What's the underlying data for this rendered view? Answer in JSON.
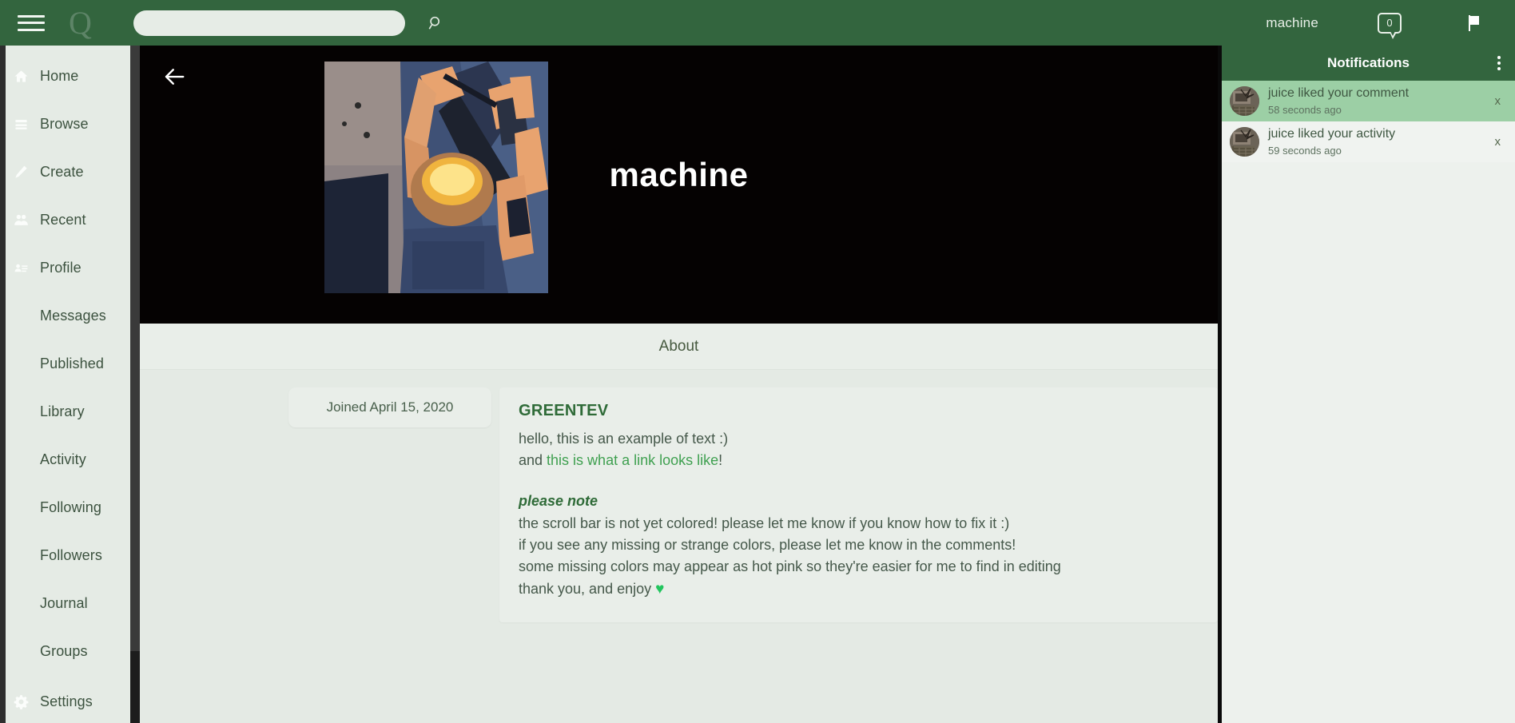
{
  "topbar": {
    "menu_icon": "hamburger-icon",
    "brand_mark": "Q",
    "search_value": "",
    "search_placeholder": "",
    "search_icon": "search-icon",
    "username": "machine",
    "messages_count": "0",
    "flag_icon": "flag-icon"
  },
  "sidebar": {
    "items": [
      {
        "label": "Home",
        "icon": "home-icon"
      },
      {
        "label": "Browse",
        "icon": "list-icon"
      },
      {
        "label": "Create",
        "icon": "pencil-icon"
      },
      {
        "label": "Recent",
        "icon": "people-icon"
      },
      {
        "label": "Profile",
        "icon": "id-card-icon"
      },
      {
        "label": "Messages",
        "icon": ""
      },
      {
        "label": "Published",
        "icon": ""
      },
      {
        "label": "Library",
        "icon": ""
      },
      {
        "label": "Activity",
        "icon": ""
      },
      {
        "label": "Following",
        "icon": ""
      },
      {
        "label": "Followers",
        "icon": ""
      },
      {
        "label": "Journal",
        "icon": ""
      },
      {
        "label": "Groups",
        "icon": ""
      }
    ],
    "settings": {
      "label": "Settings",
      "icon": "gear-icon"
    }
  },
  "profile": {
    "back_icon": "back-arrow-icon",
    "display_name": "machine",
    "avatar_alt": "comic-art-avatar",
    "tabs": [
      {
        "label": "About",
        "active": true
      }
    ],
    "joined": "Joined April 15, 2020",
    "about": {
      "heading": "GREENTEV",
      "line1": "hello, this is an example of text :)",
      "line2_prefix": "and ",
      "link_text": "this is what a link looks like",
      "line2_suffix": "!",
      "note_title": "please note",
      "note_lines": [
        "the scroll bar is not yet colored! please let me know if you know how to fix it :)",
        "if you see any missing or strange colors, please let me know in the comments!",
        "some missing colors may appear as hot pink so they're easier for me to find in editing"
      ],
      "thanks_text": "thank you, and enjoy ",
      "thanks_emoji": "♥"
    }
  },
  "notifications": {
    "title": "Notifications",
    "kebab_icon": "more-vertical-icon",
    "items": [
      {
        "actor": "juice",
        "action": " liked your comment",
        "time": "58 seconds ago",
        "close": "x",
        "unread": true
      },
      {
        "actor": "juice",
        "action": " liked your activity",
        "time": "59 seconds ago",
        "close": "x",
        "unread": false
      }
    ]
  },
  "colors": {
    "brand_green": "#33653e",
    "panel_bg": "#e8eee8",
    "link_green": "#3fa050",
    "heading_green": "#2f6b38",
    "unread_green": "#9ccfa5",
    "heart_green": "#22c55e"
  }
}
